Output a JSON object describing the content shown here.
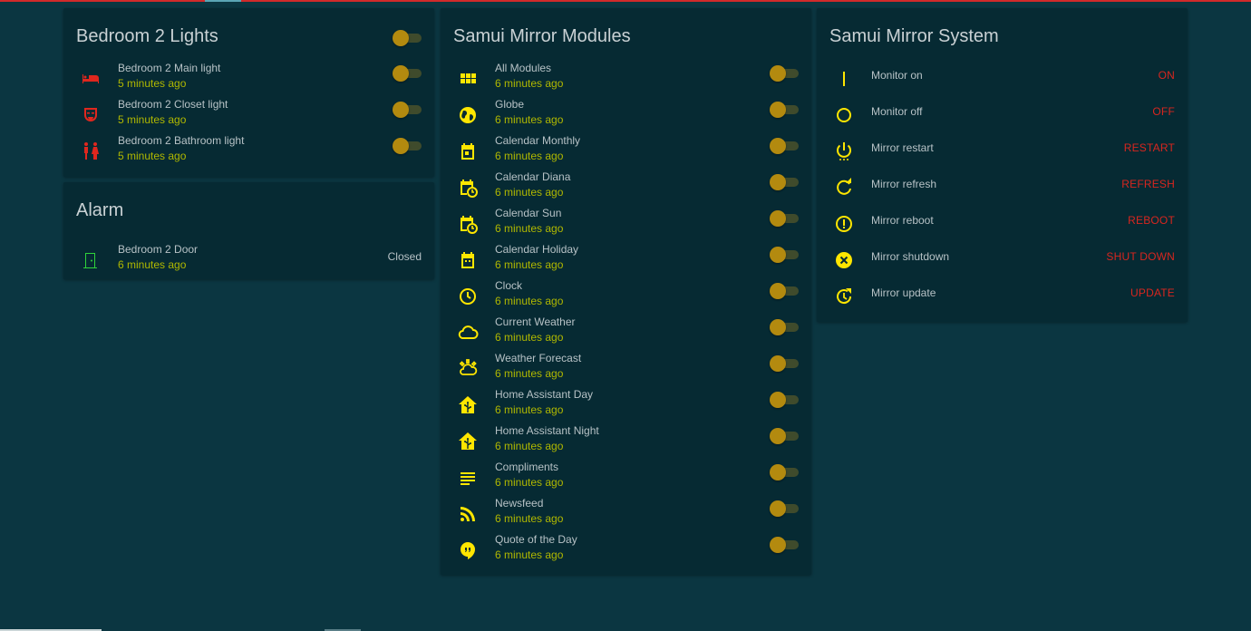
{
  "colors": {
    "background": "#0b3641",
    "card": "#062a33",
    "accent_yellow": "#ffe600",
    "time_green": "#b0b800",
    "toggle_thumb": "#b38a0f",
    "action_red": "#d8261f",
    "icon_red": "#e0271e",
    "icon_green": "#2fd33a"
  },
  "bedroom_lights": {
    "title": "Bedroom 2 Lights",
    "items": [
      {
        "name": "Bedroom 2 Main light",
        "time": "5 minutes ago",
        "icon": "bed-icon",
        "state": "off"
      },
      {
        "name": "Bedroom 2 Closet light",
        "time": "5 minutes ago",
        "icon": "mask-icon",
        "state": "off"
      },
      {
        "name": "Bedroom 2 Bathroom light",
        "time": "5 minutes ago",
        "icon": "human-male-female-icon",
        "state": "off"
      }
    ]
  },
  "alarm": {
    "title": "Alarm",
    "items": [
      {
        "name": "Bedroom 2 Door",
        "time": "6 minutes ago",
        "state": "Closed",
        "icon": "door-icon"
      }
    ]
  },
  "modules": {
    "title": "Samui Mirror Modules",
    "items": [
      {
        "name": "All Modules",
        "time": "6 minutes ago",
        "icon": "view-module-icon",
        "state": "off"
      },
      {
        "name": "Globe",
        "time": "6 minutes ago",
        "icon": "globe-icon",
        "state": "off"
      },
      {
        "name": "Calendar Monthly",
        "time": "6 minutes ago",
        "icon": "calendar-icon",
        "state": "off"
      },
      {
        "name": "Calendar Diana",
        "time": "6 minutes ago",
        "icon": "calendar-clock-icon",
        "state": "off"
      },
      {
        "name": "Calendar Sun",
        "time": "6 minutes ago",
        "icon": "calendar-clock-icon",
        "state": "off"
      },
      {
        "name": "Calendar Holiday",
        "time": "6 minutes ago",
        "icon": "calendar-blank-icon",
        "state": "off"
      },
      {
        "name": "Clock",
        "time": "6 minutes ago",
        "icon": "clock-icon",
        "state": "off"
      },
      {
        "name": "Current Weather",
        "time": "6 minutes ago",
        "icon": "cloud-icon",
        "state": "off"
      },
      {
        "name": "Weather Forecast",
        "time": "6 minutes ago",
        "icon": "weather-partly-cloudy-icon",
        "state": "off"
      },
      {
        "name": "Home Assistant Day",
        "time": "6 minutes ago",
        "icon": "home-assistant-icon",
        "state": "off"
      },
      {
        "name": "Home Assistant Night",
        "time": "6 minutes ago",
        "icon": "home-assistant-icon",
        "state": "off"
      },
      {
        "name": "Compliments",
        "time": "6 minutes ago",
        "icon": "text-lines-icon",
        "state": "off"
      },
      {
        "name": "Newsfeed",
        "time": "6 minutes ago",
        "icon": "rss-icon",
        "state": "off"
      },
      {
        "name": "Quote of the Day",
        "time": "6 minutes ago",
        "icon": "quote-bubble-icon",
        "state": "off"
      }
    ]
  },
  "system": {
    "title": "Samui Mirror System",
    "items": [
      {
        "name": "Monitor on",
        "action": "ON",
        "icon": "power-on-icon"
      },
      {
        "name": "Monitor off",
        "action": "OFF",
        "icon": "power-off-icon"
      },
      {
        "name": "Mirror restart",
        "action": "RESTART",
        "icon": "power-settings-icon"
      },
      {
        "name": "Mirror refresh",
        "action": "REFRESH",
        "icon": "refresh-icon"
      },
      {
        "name": "Mirror reboot",
        "action": "REBOOT",
        "icon": "alert-circle-icon"
      },
      {
        "name": "Mirror shutdown",
        "action": "SHUT DOWN",
        "icon": "close-circle-icon"
      },
      {
        "name": "Mirror update",
        "action": "UPDATE",
        "icon": "update-icon"
      }
    ]
  }
}
